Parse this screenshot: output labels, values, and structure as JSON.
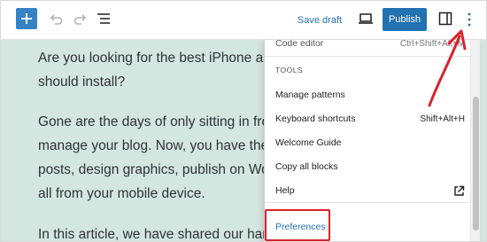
{
  "toolbar": {
    "add_icon": "plus-icon",
    "undo_icon": "undo-icon",
    "redo_icon": "redo-icon",
    "list_view_icon": "list-view-icon",
    "save_draft_label": "Save draft",
    "preview_icon": "laptop-icon",
    "publish_label": "Publish",
    "settings_icon": "sidebar-toggle-icon",
    "options_icon": "vertical-ellipsis-icon",
    "accent_color": "#2271b1",
    "add_color": "#3582c4"
  },
  "content": {
    "paragraphs": [
      "Are you looking for the best iPhone ap\nshould install?",
      "Gone are the days of only sitting in fro\nmanage your blog. Now, you have the\nposts, design graphics, publish on Wor\nall from your mobile device.",
      "In this article, we have shared our hanc"
    ],
    "canvas_color": "#d3e6df"
  },
  "options_menu": {
    "cut_item_label": "Code editor",
    "cut_item_shortcut": "Ctrl+Shift+Alt+M",
    "group_title": "TOOLS",
    "items": [
      {
        "label": "Manage patterns",
        "shortcut": ""
      },
      {
        "label": "Keyboard shortcuts",
        "shortcut": "Shift+Alt+H"
      },
      {
        "label": "Welcome Guide",
        "shortcut": ""
      },
      {
        "label": "Copy all blocks",
        "shortcut": ""
      },
      {
        "label": "Help",
        "icon": "external-link-icon"
      }
    ],
    "preferences_label": "Preferences",
    "highlight_color": "#d8232a"
  }
}
